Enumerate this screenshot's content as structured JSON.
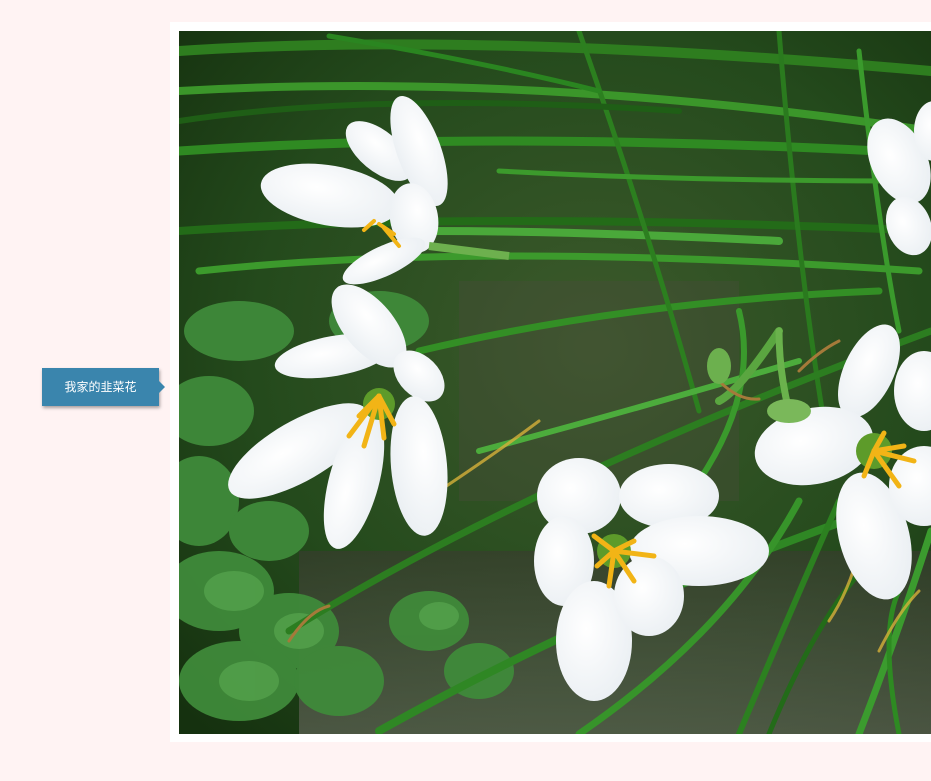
{
  "caption": {
    "text": "我家的韭菜花",
    "color": "#3a85ad"
  },
  "photo": {
    "subject": "white-rain-lily-flowers-icon"
  },
  "colors": {
    "page_background": "#fff3f3",
    "frame": "#ffffff",
    "leaf_dark": "#1d3d16",
    "leaf_light": "#3f8a2e",
    "petal": "#ffffff",
    "stamen": "#f5c518"
  }
}
